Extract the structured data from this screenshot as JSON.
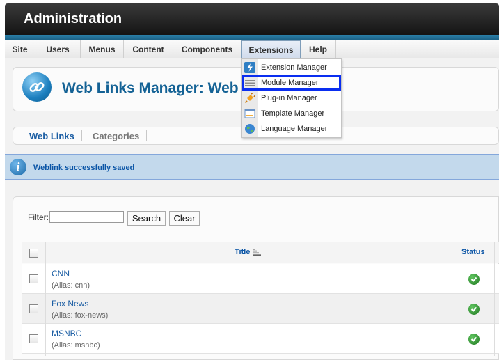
{
  "header": {
    "title": "Administration"
  },
  "menu": {
    "items": [
      "Site",
      "Users",
      "Menus",
      "Content",
      "Components",
      "Extensions",
      "Help"
    ],
    "active": "Extensions"
  },
  "extensions_menu": {
    "items": [
      {
        "label": "Extension Manager",
        "icon": "extension-bolt-icon"
      },
      {
        "label": "Module Manager",
        "icon": "module-list-icon",
        "highlighted": true
      },
      {
        "label": "Plug-in Manager",
        "icon": "plugin-plug-icon"
      },
      {
        "label": "Template Manager",
        "icon": "template-window-icon"
      },
      {
        "label": "Language Manager",
        "icon": "language-globe-icon"
      }
    ]
  },
  "toolbar": {
    "title": "Web Links Manager: Web",
    "icon": "chain-link-icon"
  },
  "subtabs": [
    "Web Links",
    "Categories"
  ],
  "message": {
    "text": "Weblink successfully saved",
    "icon": "info-icon"
  },
  "filter": {
    "label": "Filter:",
    "value": "",
    "search_label": "Search",
    "clear_label": "Clear"
  },
  "table": {
    "columns": {
      "title": "Title",
      "status": "Status"
    },
    "rows": [
      {
        "name": "CNN",
        "alias": "(Alias: cnn)",
        "status": "published"
      },
      {
        "name": "Fox News",
        "alias": "(Alias: fox-news)",
        "status": "published"
      },
      {
        "name": "MSNBC",
        "alias": "(Alias: msnbc)",
        "status": "published"
      }
    ]
  },
  "colors": {
    "accent_blue": "#146295",
    "link_blue": "#1a5da3",
    "message_bg": "#c3d9ec",
    "highlight_border": "#0a2ef0",
    "status_green": "#237a23"
  }
}
